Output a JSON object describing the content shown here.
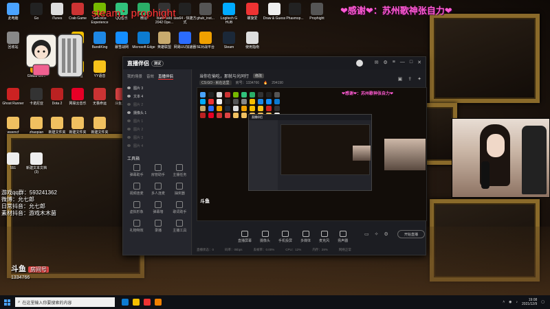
{
  "overlay": {
    "steam_tag": "steam：prophight",
    "thanks": "❤感谢❤：苏州歌神张自力❤",
    "streamer_info": [
      "游戏qq群：593241362",
      "微博：允七郎",
      "日常抖音：允七郎",
      "素材抖音：游戏木木菌"
    ],
    "douyu_logo": "斗鱼",
    "room_label": "房间号",
    "room_number": "1334766"
  },
  "desktop_icons": [
    {
      "label": "此电脑",
      "color": "#4aa3ff"
    },
    {
      "label": "Go",
      "color": "#222"
    },
    {
      "label": "iTunes",
      "color": "#ddd"
    },
    {
      "label": "Crab Game",
      "color": "#c33"
    },
    {
      "label": "GeForce Experience",
      "color": "#76b900"
    },
    {
      "label": "QQ音乐",
      "color": "#31c27c"
    },
    {
      "label": "微信",
      "color": "#2aae67"
    },
    {
      "label": "Battlefield 2042 Ope...",
      "color": "#333"
    },
    {
      "label": "obs64 - 快捷方式",
      "color": "#222"
    },
    {
      "label": "ghub_inst...",
      "color": "#555"
    },
    {
      "label": "Logitech G HUB",
      "color": "#0af"
    },
    {
      "label": "螺旋爱",
      "color": "#e33"
    },
    {
      "label": "Draw & Guess",
      "color": "#eee"
    },
    {
      "label": "Phasmop...",
      "color": "#222"
    },
    {
      "label": "Prophight",
      "color": "#555"
    },
    {
      "label": "回收站",
      "color": "#888"
    },
    {
      "label": "开黑啦",
      "color": "#f5c000"
    },
    {
      "label": "BandiKing",
      "color": "#1e88e5"
    },
    {
      "label": "暴雪战网",
      "color": "#148eff"
    },
    {
      "label": "Microsoft Edge",
      "color": "#0c7bd1"
    },
    {
      "label": "英雄联盟",
      "color": "#c8aa6e"
    },
    {
      "label": "网易UU加速器",
      "color": "#2b6cff"
    },
    {
      "label": "5E对战平台",
      "color": "#f0a000"
    },
    {
      "label": "Steam",
      "color": "#1b2838"
    },
    {
      "label": "使用指南",
      "color": "#ddd"
    },
    {
      "label": "Global Off...",
      "color": "#f0a000"
    },
    {
      "label": "开黑啦",
      "color": "#f5c000"
    },
    {
      "label": "YY语音",
      "color": "#f7c21a"
    },
    {
      "label": "Ghost Runner",
      "color": "#c22"
    },
    {
      "label": "卡诺尼亚",
      "color": "#333"
    },
    {
      "label": "Dota 2",
      "color": "#b22"
    },
    {
      "label": "网易云音乐",
      "color": "#e60026"
    },
    {
      "label": "无畏命运",
      "color": "#c33"
    },
    {
      "label": "斗鱼直播",
      "color": "#d44"
    },
    {
      "label": "wwencf",
      "color": "#f0c060"
    },
    {
      "label": "zhaopian",
      "color": "#f0c060"
    },
    {
      "label": "新建文件夹",
      "color": "#f0c060"
    },
    {
      "label": "新建文件夹",
      "color": "#f0c060"
    },
    {
      "label": "新建文件夹",
      "color": "#f0c060"
    },
    {
      "label": "551",
      "color": "#eee"
    },
    {
      "label": "新建文本文档(3)",
      "color": "#eee"
    }
  ],
  "app": {
    "logo": "直播伴侣",
    "badge": "测试",
    "tabs": [
      "我的场景",
      "音效",
      "直播伴侣"
    ],
    "active_tab": "直播伴侣",
    "layers": [
      {
        "label": "图片 3",
        "visible": true
      },
      {
        "label": "文本 4",
        "visible": true
      },
      {
        "label": "图片 2",
        "visible": false
      },
      {
        "label": "摄像头 1",
        "visible": true
      },
      {
        "label": "图片 1",
        "visible": false
      },
      {
        "label": "图片 2",
        "visible": false
      },
      {
        "label": "图片 3",
        "visible": false
      },
      {
        "label": "图片 4",
        "visible": false
      }
    ],
    "tools_title": "工具箱",
    "tools": [
      "弹幕助手",
      "房管助手",
      "主播任务",
      "视频连麦",
      "多人连麦",
      "抽奖器",
      "虚拟形象",
      "弹幕墙",
      "歌词助手",
      "礼物特效",
      "录播",
      "主播工具"
    ],
    "room_title": "当你在偷吃，那就与光同行",
    "room_title_tag": "修改",
    "room_tag": "CS:GO - 就在这里",
    "room_id_label": "房号：1334766",
    "room_online": "294190",
    "preview_thanks": "❤感谢❤：苏州歌神张自力❤",
    "preview_douyu": "斗鱼",
    "preview_window_title": "直播伴侣",
    "controls": [
      "直播屏幕",
      "摄像头",
      "手机投屏",
      "多媒体",
      "麦克风",
      "扬声器"
    ],
    "start_label": "开始直播",
    "status": [
      "直播状态：0",
      "码率：0kbps",
      "丢帧率：0.00%",
      "CPU：12%",
      "内存：28%",
      "网络正常"
    ]
  },
  "taskbar": {
    "search_placeholder": "在这里输入你要搜索的内容",
    "apps": [
      "#0c7bd1",
      "#f5c000",
      "#e33",
      "#f08000"
    ],
    "time": "19:08",
    "date": "2021/12/9"
  },
  "colors": {
    "accent": "#ff3a3a",
    "pink": "#ff5bd3"
  }
}
